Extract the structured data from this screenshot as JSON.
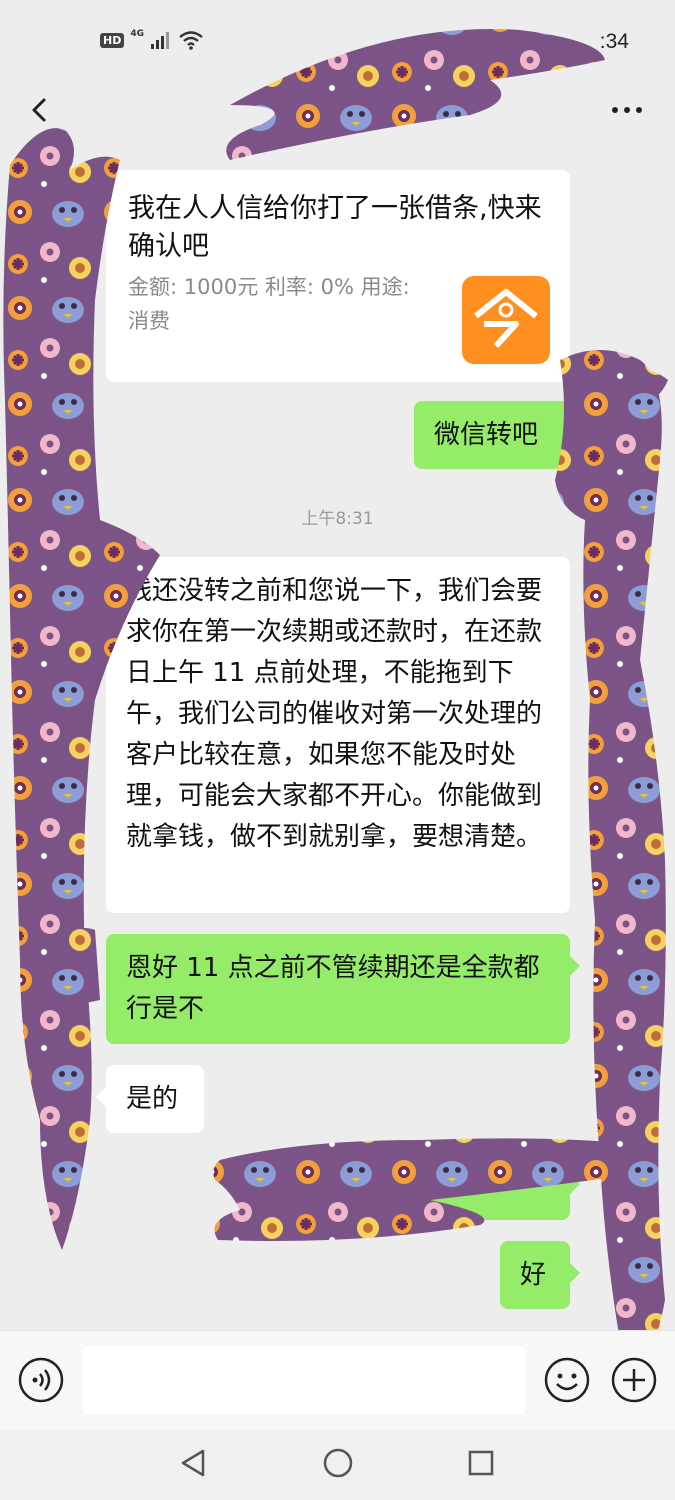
{
  "status_bar": {
    "hd": "HD",
    "network": "4G",
    "time_partial": ":34"
  },
  "top_bar": {
    "back_icon": "chevron-left-icon",
    "more_icon": "more-dots-icon"
  },
  "messages": [
    {
      "direction": "incoming",
      "type": "iou-card",
      "title": "我在人人信给你打了一张借条,快来确认吧",
      "description": "金额: 1000元 利率: 0% 用途: 消费",
      "logo_color": "#FF8F1F"
    },
    {
      "direction": "outgoing",
      "text": "微信转吧"
    },
    {
      "type": "timestamp",
      "text": "上午8:31"
    },
    {
      "direction": "incoming",
      "text": "钱还没转之前和您说一下，我们会要求你在第一次续期或还款时，在还款日上午 11 点前处理，不能拖到下午，我们公司的催收对第一次处理的客户比较在意，如果您不能及时处理，可能会大家都不开心。你能做到就拿钱，做不到就别拿，要想清楚。"
    },
    {
      "direction": "outgoing",
      "text": "恩好 11 点之前不管续期还是全款都行是不"
    },
    {
      "direction": "incoming",
      "text": "是的"
    },
    {
      "direction": "outgoing",
      "text": "好"
    }
  ],
  "input_bar": {
    "voice_icon": "voice-icon",
    "emoji_icon": "emoji-icon",
    "plus_icon": "plus-icon",
    "placeholder": ""
  },
  "nav_bar": {
    "back_icon": "triangle-back-icon",
    "home_icon": "circle-home-icon",
    "recents_icon": "square-recents-icon"
  },
  "colors": {
    "chat_background": "#EDEDED",
    "outgoing_bubble": "#95EC69",
    "incoming_bubble": "#FFFFFF",
    "redaction_purple": "#7B5387"
  }
}
